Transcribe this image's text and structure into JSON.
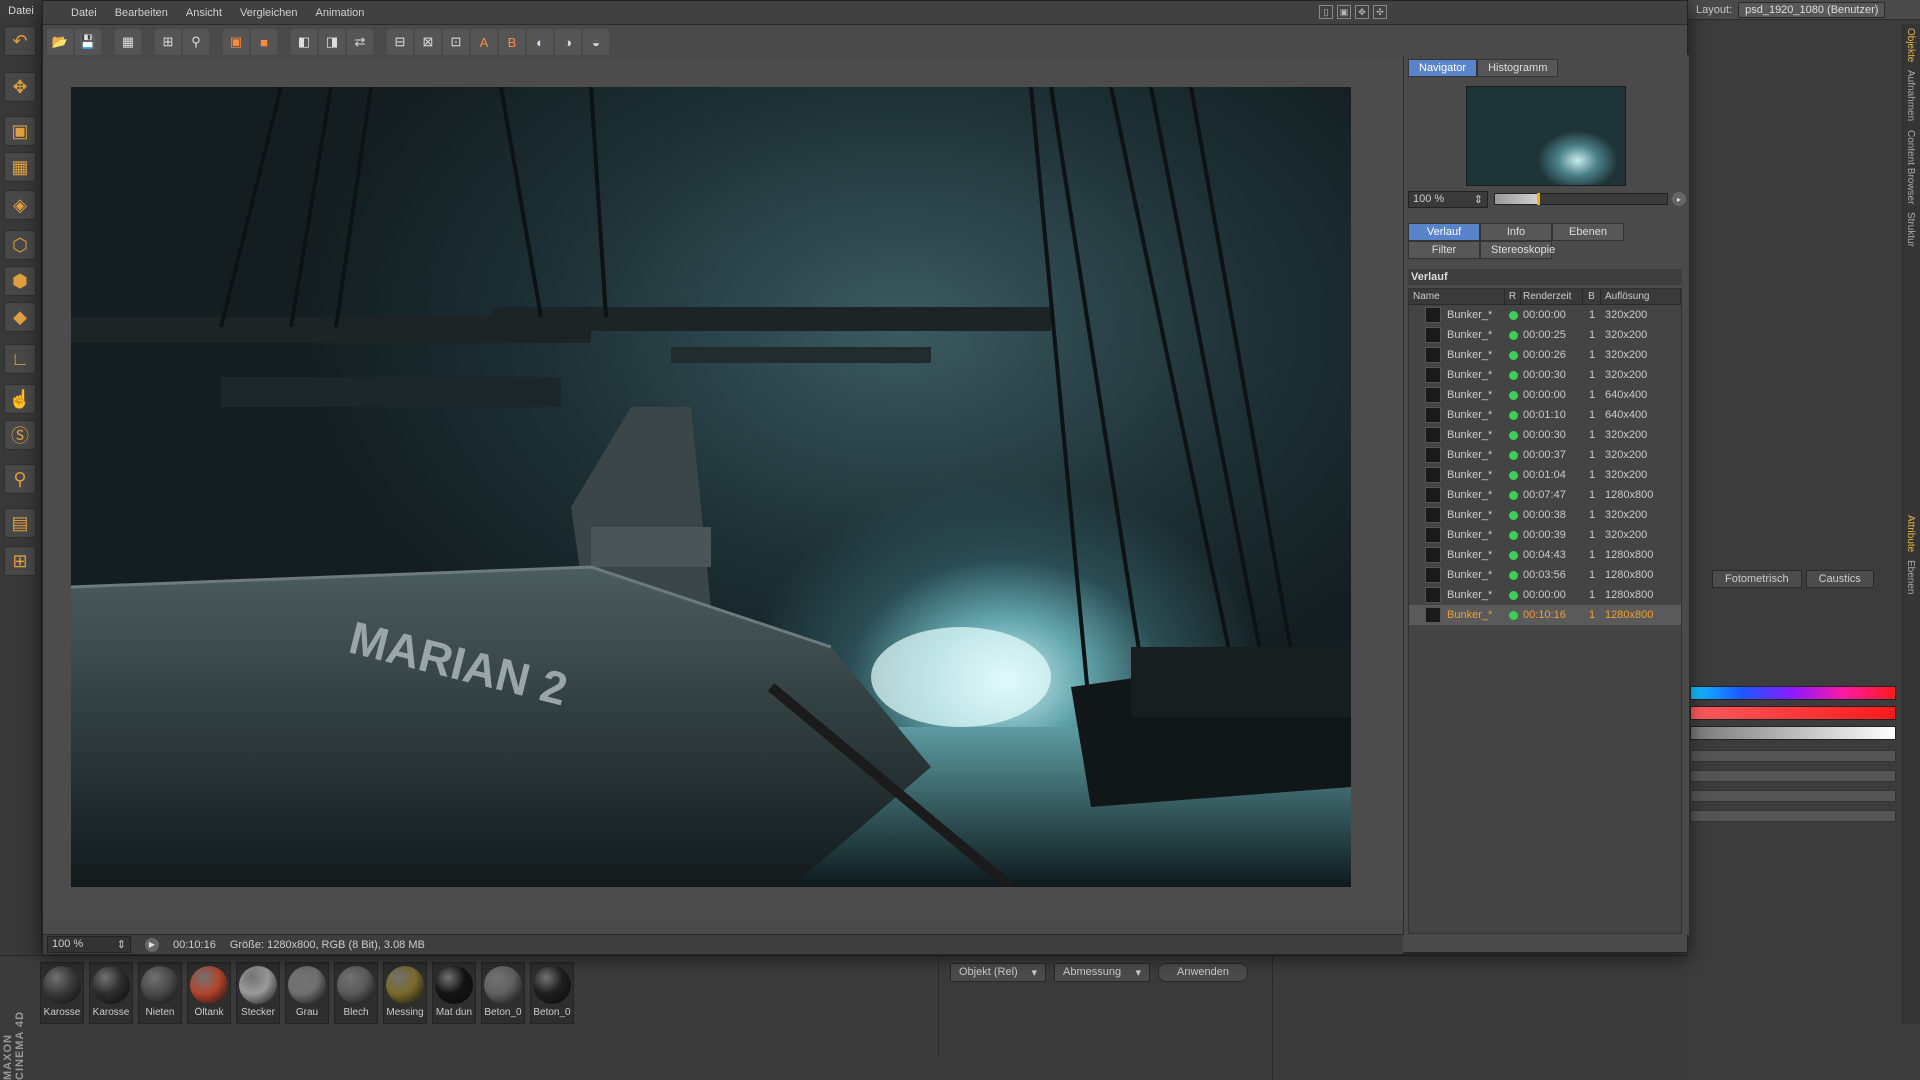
{
  "app": {
    "main_menu_first": "Datei",
    "layout_label": "Layout:",
    "layout_value": "psd_1920_1080 (Benutzer)",
    "side_tabs": [
      "Objekte",
      "Aufnahmen",
      "Content Browser",
      "Struktur",
      "Attribute",
      "Ebenen"
    ],
    "attr_tabs": [
      "Fotometrisch",
      "Caustics"
    ],
    "materials": [
      {
        "label": "Karosse",
        "color": "#3a3a3a"
      },
      {
        "label": "Karosse",
        "color": "#2d2d2d"
      },
      {
        "label": "Nieten",
        "color": "#4a4a4a"
      },
      {
        "label": "Öltank",
        "color": "#b2452d"
      },
      {
        "label": "Stecker",
        "color": "#9a9a9a"
      },
      {
        "label": "Grau",
        "color": "#707070"
      },
      {
        "label": "Blech",
        "color": "#5a5a5a"
      },
      {
        "label": "Messing",
        "color": "#7a6a2a"
      },
      {
        "label": "Mat dun",
        "color": "#141414"
      },
      {
        "label": "Beton_0",
        "color": "#606060"
      },
      {
        "label": "Beton_0",
        "color": "#1e1e1e"
      }
    ],
    "maxon_logo": "MAXON CINEMA 4D",
    "coord": {
      "mode": "Objekt (Rel)",
      "size": "Abmessung",
      "apply": "Anwenden"
    }
  },
  "viewer": {
    "menu": [
      "Datei",
      "Bearbeiten",
      "Ansicht",
      "Vergleichen",
      "Animation"
    ],
    "status": {
      "zoom": "100 %",
      "time": "00:10:16",
      "info": "Größe: 1280x800, RGB (8 Bit), 3.08 MB"
    },
    "render_text": "MARIAN 2"
  },
  "panel": {
    "top_tabs": [
      "Navigator",
      "Histogramm"
    ],
    "nav_zoom": "100 %",
    "nav_slider_fraction": 0.25,
    "hist_tabs_row1": [
      "Verlauf",
      "Info",
      "Ebenen"
    ],
    "hist_tabs_row2": [
      "Filter",
      "Stereoskopie"
    ],
    "section_title": "Verlauf",
    "columns": [
      "Name",
      "R",
      "Renderzeit",
      "B",
      "Auflösung"
    ],
    "rows": [
      {
        "name": "Bunker_*",
        "time": "00:00:00",
        "b": "1",
        "res": "320x200"
      },
      {
        "name": "Bunker_*",
        "time": "00:00:25",
        "b": "1",
        "res": "320x200"
      },
      {
        "name": "Bunker_*",
        "time": "00:00:26",
        "b": "1",
        "res": "320x200"
      },
      {
        "name": "Bunker_*",
        "time": "00:00:30",
        "b": "1",
        "res": "320x200"
      },
      {
        "name": "Bunker_*",
        "time": "00:00:00",
        "b": "1",
        "res": "640x400"
      },
      {
        "name": "Bunker_*",
        "time": "00:01:10",
        "b": "1",
        "res": "640x400"
      },
      {
        "name": "Bunker_*",
        "time": "00:00:30",
        "b": "1",
        "res": "320x200"
      },
      {
        "name": "Bunker_*",
        "time": "00:00:37",
        "b": "1",
        "res": "320x200"
      },
      {
        "name": "Bunker_*",
        "time": "00:01:04",
        "b": "1",
        "res": "320x200"
      },
      {
        "name": "Bunker_*",
        "time": "00:07:47",
        "b": "1",
        "res": "1280x800"
      },
      {
        "name": "Bunker_*",
        "time": "00:00:38",
        "b": "1",
        "res": "320x200"
      },
      {
        "name": "Bunker_*",
        "time": "00:00:39",
        "b": "1",
        "res": "320x200"
      },
      {
        "name": "Bunker_*",
        "time": "00:04:43",
        "b": "1",
        "res": "1280x800"
      },
      {
        "name": "Bunker_*",
        "time": "00:03:56",
        "b": "1",
        "res": "1280x800"
      },
      {
        "name": "Bunker_*",
        "time": "00:00:00",
        "b": "1",
        "res": "1280x800"
      },
      {
        "name": "Bunker_*",
        "time": "00:10:16",
        "b": "1",
        "res": "1280x800",
        "selected": true
      }
    ]
  }
}
